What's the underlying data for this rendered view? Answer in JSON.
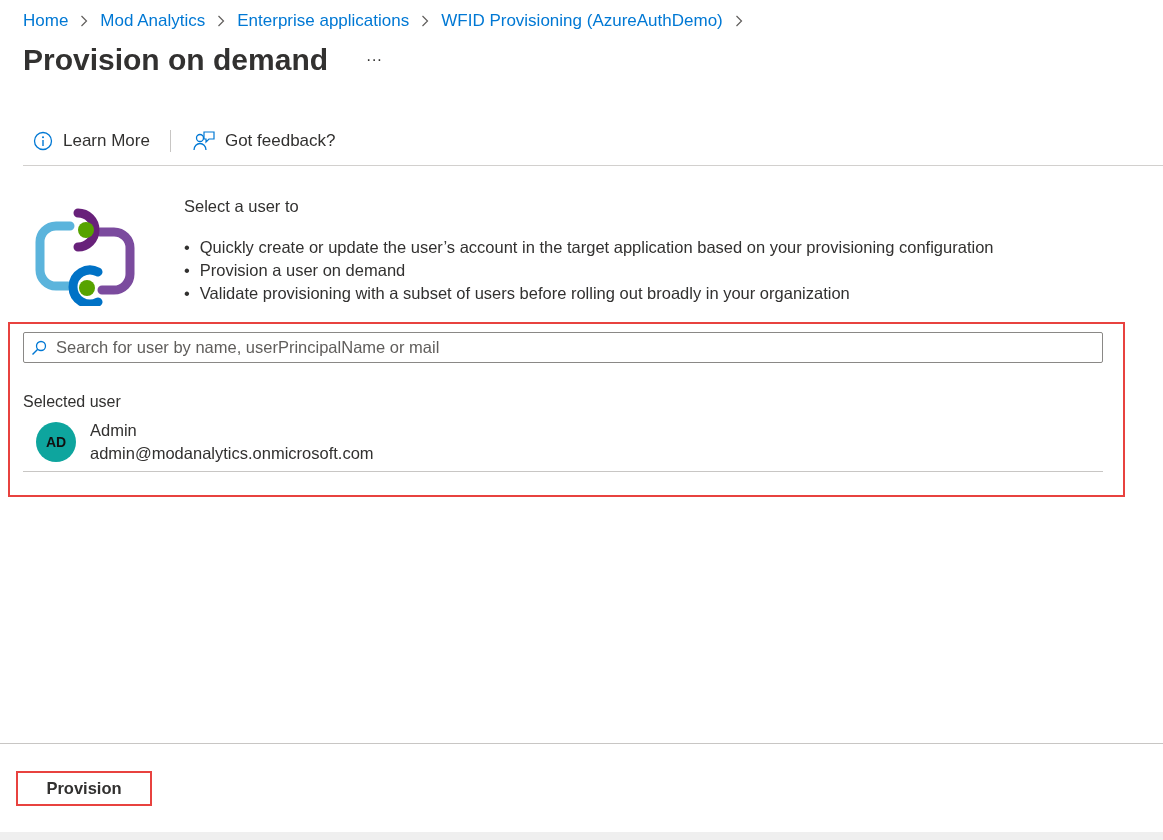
{
  "breadcrumb": [
    "Home",
    "Mod Analytics",
    "Enterprise applications",
    "WFID Provisioning (AzureAuthDemo)"
  ],
  "title": "Provision on demand",
  "more": "···",
  "toolbar": [
    {
      "kind": "info",
      "label": "Learn More"
    },
    {
      "kind": "feedback",
      "label": "Got feedback?"
    }
  ],
  "intro": {
    "heading": "Select a user to",
    "marker": "•",
    "bullets": [
      "Quickly create or update the user’s account in the target application based on your provisioning configuration",
      "Provision a user on demand",
      "Validate provisioning with a subset of users before rolling out broadly in your organization"
    ]
  },
  "search": {
    "placeholder": "Search for user by name, userPrincipalName or mail"
  },
  "selected_user": {
    "label": "Selected user",
    "initials": "AD",
    "name": "Admin",
    "email": "admin@modanalytics.onmicrosoft.com"
  },
  "footer": {
    "button": "Provision"
  }
}
